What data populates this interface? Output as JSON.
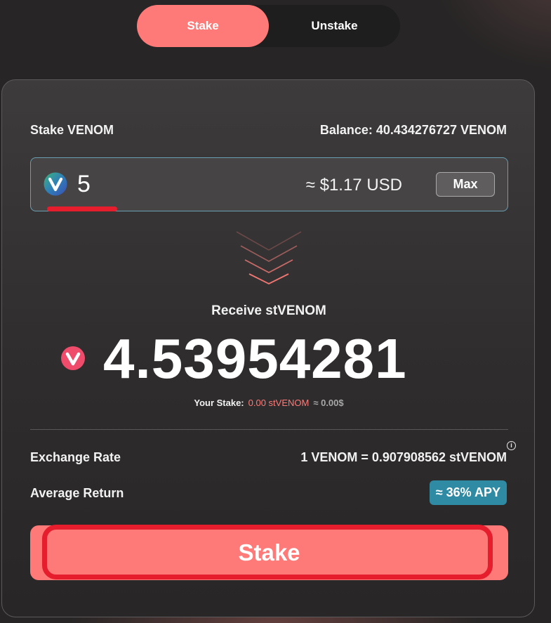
{
  "tabs": {
    "stake": "Stake",
    "unstake": "Unstake"
  },
  "stake_form": {
    "title": "Stake VENOM",
    "balance": "Balance: 40.434276727 VENOM",
    "amount_value": "5",
    "usd_estimate": "≈ $1.17 USD",
    "max_label": "Max"
  },
  "receive": {
    "label": "Receive stVENOM",
    "amount": "4.53954281",
    "your_stake_label": "Your Stake:",
    "your_stake_amount": "0.00 stVENOM",
    "your_stake_usd": "≈ 0.00$"
  },
  "details": {
    "exchange_rate_label": "Exchange Rate",
    "exchange_rate_value": "1 VENOM = 0.907908562 stVENOM",
    "info_icon": "info-icon",
    "average_return_label": "Average Return",
    "apy_badge": "≈ 36% APY"
  },
  "actions": {
    "stake_button": "Stake"
  },
  "colors": {
    "accent": "#fe7a78",
    "apy_badge": "#2f8aa3",
    "annotation_red": "#e51d2c",
    "background": "#272525"
  }
}
